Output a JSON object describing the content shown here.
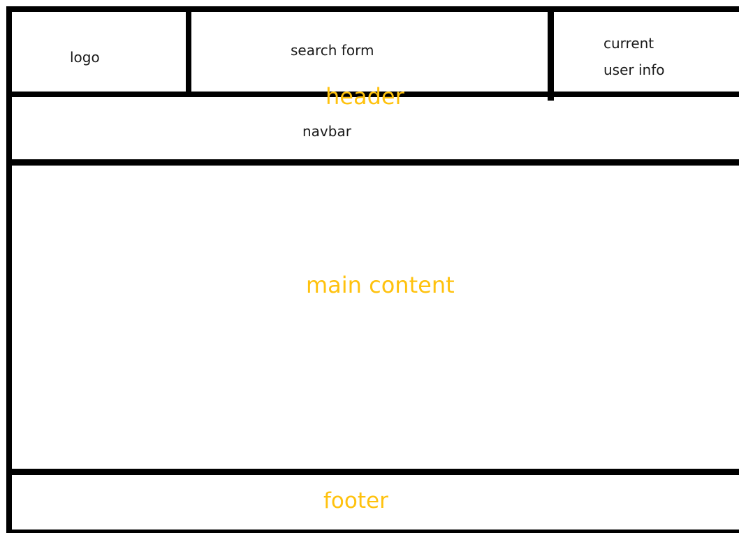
{
  "diagram": {
    "regions": {
      "logo": "logo",
      "search_form": "search form",
      "current_user_info_line1": "current",
      "current_user_info_line2": "user info",
      "header": "header",
      "navbar": "navbar",
      "main_content": "main content",
      "footer": "footer"
    },
    "colors": {
      "outline": "#000000",
      "region_label": "#1a1a1a",
      "section_label": "#ffc20e",
      "background": "#ffffff"
    }
  }
}
